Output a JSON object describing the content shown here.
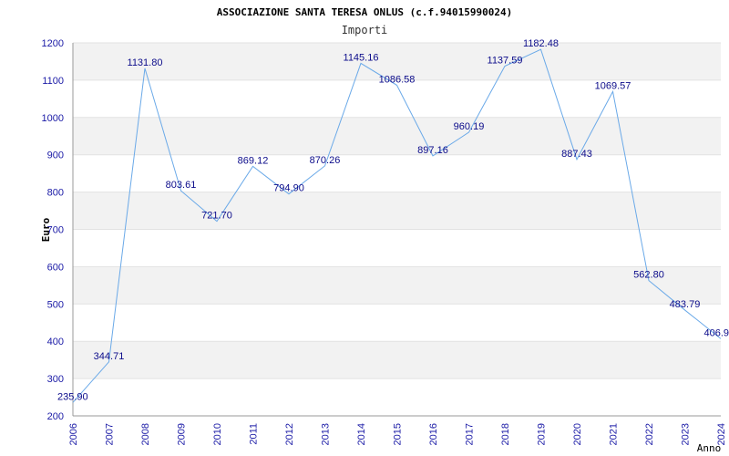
{
  "chart_data": {
    "type": "line",
    "title": "ASSOCIAZIONE SANTA TERESA ONLUS (c.f.94015990024)",
    "subtitle": "Importi",
    "xlabel": "Anno",
    "ylabel": "Euro",
    "x": [
      "2006",
      "2007",
      "2008",
      "2009",
      "2010",
      "2011",
      "2012",
      "2013",
      "2014",
      "2015",
      "2016",
      "2017",
      "2018",
      "2019",
      "2020",
      "2021",
      "2022",
      "2023",
      "2024"
    ],
    "values": [
      235.9,
      344.71,
      1131.8,
      803.61,
      721.7,
      869.12,
      794.9,
      870.26,
      1145.16,
      1086.58,
      897.16,
      960.19,
      1137.59,
      1182.48,
      887.43,
      1069.57,
      562.8,
      483.79,
      406.9
    ],
    "value_labels": [
      "235.90",
      "344.71",
      "1131.80",
      "803.61",
      "721.70",
      "869.12",
      "794.90",
      "870.26",
      "1145.16",
      "1086.58",
      "897.16",
      "960.19",
      "1137.59",
      "1182.48",
      "887.43",
      "1069.57",
      "562.80",
      "483.79",
      "406.9"
    ],
    "ylim": [
      200,
      1200
    ],
    "yticks": [
      "200",
      "300",
      "400",
      "500",
      "600",
      "700",
      "800",
      "900",
      "1000",
      "1100",
      "1200"
    ],
    "grid": "horizontal bands",
    "legend": "none",
    "colors": {
      "line": "#6aa9e8",
      "band": "#f2f2f2",
      "tick_text": "#1a1aa6",
      "label_text": "#0b0b8a"
    }
  }
}
